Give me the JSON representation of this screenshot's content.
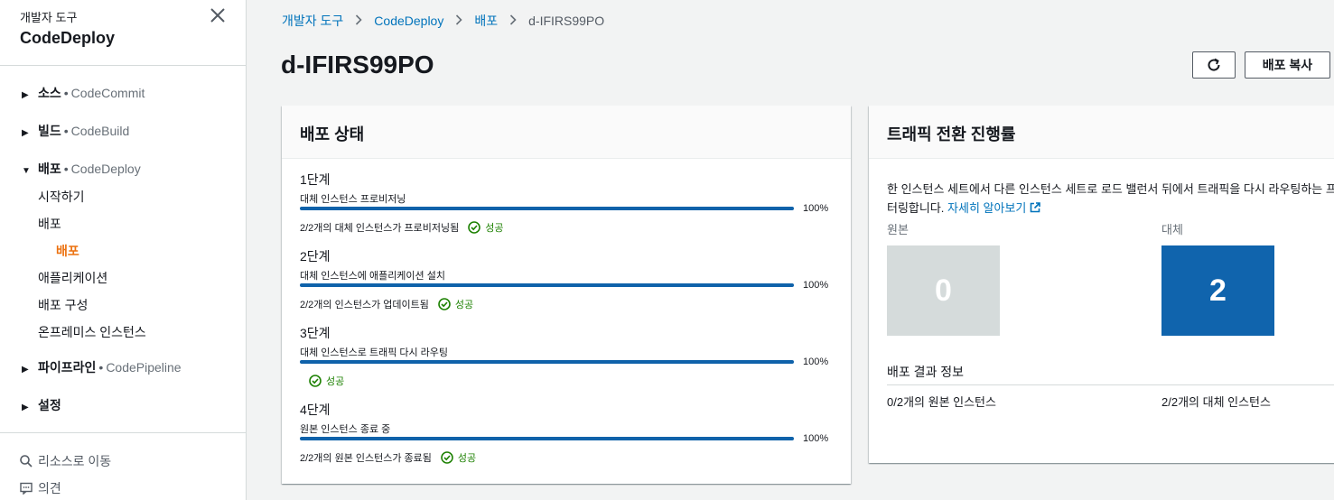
{
  "sidebar": {
    "eyebrow": "개발자 도구",
    "title": "CodeDeploy",
    "sections": [
      {
        "label": "소스",
        "sub": "CodeCommit"
      },
      {
        "label": "빌드",
        "sub": "CodeBuild"
      },
      {
        "label": "배포",
        "sub": "CodeDeploy"
      },
      {
        "label": "파이프라인",
        "sub": "CodePipeline"
      },
      {
        "label": "설정",
        "sub": ""
      }
    ],
    "deploy_items": [
      "시작하기",
      "배포",
      "배포",
      "애플리케이션",
      "배포 구성",
      "온프레미스 인스턴스"
    ],
    "footer": [
      "리소스로 이동",
      "의견"
    ]
  },
  "breadcrumb": [
    "개발자 도구",
    "CodeDeploy",
    "배포",
    "d-IFIRS99PO"
  ],
  "page_title": "d-IFIRS99PO",
  "buttons": {
    "copy": "배포 복사"
  },
  "status_card": {
    "title": "배포 상태",
    "steps": [
      {
        "title": "1단계",
        "desc": "대체 인스턴스 프로비저닝",
        "progress": 100,
        "percent": "100%",
        "result": "2/2개의 대체 인스턴스가 프로비저닝됨",
        "status": "성공"
      },
      {
        "title": "2단계",
        "desc": "대체 인스턴스에 애플리케이션 설치",
        "progress": 100,
        "percent": "100%",
        "result": "2/2개의 인스턴스가 업데이트됨",
        "status": "성공"
      },
      {
        "title": "3단계",
        "desc": "대체 인스턴스로 트래픽 다시 라우팅",
        "progress": 100,
        "percent": "100%",
        "result": "",
        "status": "성공"
      },
      {
        "title": "4단계",
        "desc": "원본 인스턴스 종료 중",
        "progress": 100,
        "percent": "100%",
        "result": "2/2개의 원본 인스턴스가 종료됨",
        "status": "성공"
      }
    ]
  },
  "traffic_card": {
    "title": "트래픽 전환 진행률",
    "desc_line1": "한 인스턴스 세트에서 다른 인스턴스 세트로 로드 밸런서 뒤에서 트래픽을 다시 라우팅하는 프",
    "desc_line2": "터링합니다.",
    "learn_more": "자세히 알아보기",
    "original_label": "원본",
    "original_count": "0",
    "replacement_label": "대체",
    "replacement_count": "2",
    "info_title": "배포 결과 정보",
    "original_result": "0/2개의 원본 인스턴스",
    "replacement_result": "2/2개의 대체 인스턴스"
  },
  "colors": {
    "accent": "#ec7211",
    "link": "#0073bb",
    "success": "#1d8102",
    "progress": "#0f62aa",
    "replacement": "#1064ad"
  }
}
